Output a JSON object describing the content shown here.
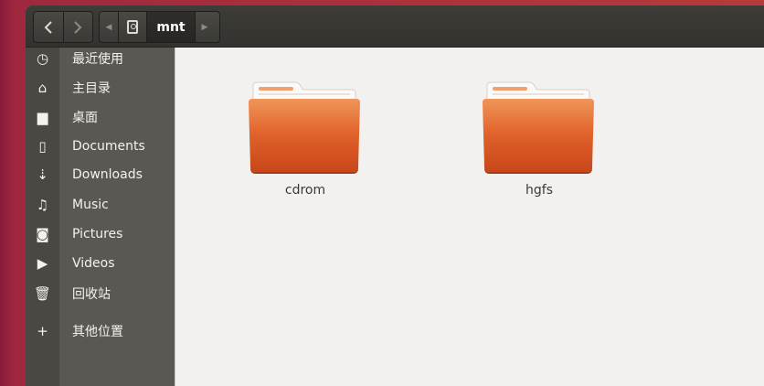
{
  "header": {
    "back_icon": "chevron-left-icon",
    "forward_icon": "chevron-right-icon",
    "path": {
      "root_icon": "drive-icon",
      "current_segment": "mnt"
    }
  },
  "sidebar": {
    "items": [
      {
        "label": "最近使用",
        "icon": "clock-icon",
        "glyph": "◷"
      },
      {
        "label": "主目录",
        "icon": "home-icon",
        "glyph": "⌂"
      },
      {
        "label": "桌面",
        "icon": "folder-icon",
        "glyph": "▆"
      },
      {
        "label": "Documents",
        "icon": "document-icon",
        "glyph": "▯"
      },
      {
        "label": "Downloads",
        "icon": "download-icon",
        "glyph": "⇣"
      },
      {
        "label": "Music",
        "icon": "music-icon",
        "glyph": "♫"
      },
      {
        "label": "Pictures",
        "icon": "camera-icon",
        "glyph": "◙"
      },
      {
        "label": "Videos",
        "icon": "video-icon",
        "glyph": "▶"
      },
      {
        "label": "回收站",
        "icon": "trash-icon",
        "glyph": "🗑"
      },
      {
        "label": "其他位置",
        "icon": "plus-icon",
        "glyph": "+"
      }
    ]
  },
  "files": [
    {
      "name": "cdrom",
      "icon": "folder-icon"
    },
    {
      "name": "hgfs",
      "icon": "folder-icon"
    }
  ],
  "colors": {
    "folder_orange": "#e0612a",
    "sidebar_bg": "#5a5852",
    "header_bg": "#3a3934"
  }
}
